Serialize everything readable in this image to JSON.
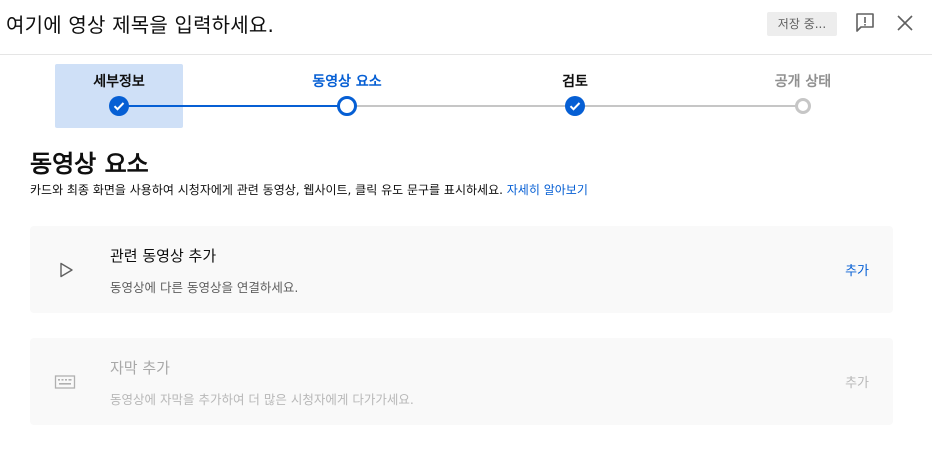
{
  "header": {
    "title_placeholder": "여기에 영상 제목을 입력하세요.",
    "save_status": "저장 중...",
    "feedback_icon": "feedback-icon",
    "close_icon": "close-icon"
  },
  "stepper": {
    "steps": [
      {
        "label": "세부정보",
        "state": "done",
        "selected": true
      },
      {
        "label": "동영상 요소",
        "state": "current",
        "selected": false
      },
      {
        "label": "검토",
        "state": "done",
        "selected": false
      },
      {
        "label": "공개 상태",
        "state": "inactive",
        "selected": false
      }
    ]
  },
  "section": {
    "title": "동영상 요소",
    "description": "카드와 최종 화면을 사용하여 시청자에게 관련 동영상, 웹사이트, 클릭 유도 문구를 표시하세요.",
    "learn_more": "자세히 알아보기"
  },
  "cards": [
    {
      "icon": "play-outline-icon",
      "title": "관련 동영상 추가",
      "subtitle": "동영상에 다른 동영상을 연결하세요.",
      "action": "추가",
      "enabled": true
    },
    {
      "icon": "keyboard-subtitles-icon",
      "title": "자막 추가",
      "subtitle": "동영상에 자막을 추가하여 더 많은 시청자에게 다가가세요.",
      "action": "추가",
      "enabled": false
    }
  ],
  "colors": {
    "accent": "#065fd4",
    "active_step_bg": "#cfe0f7",
    "inactive": "#c6c6c6",
    "card_bg": "#f9f9f9"
  }
}
